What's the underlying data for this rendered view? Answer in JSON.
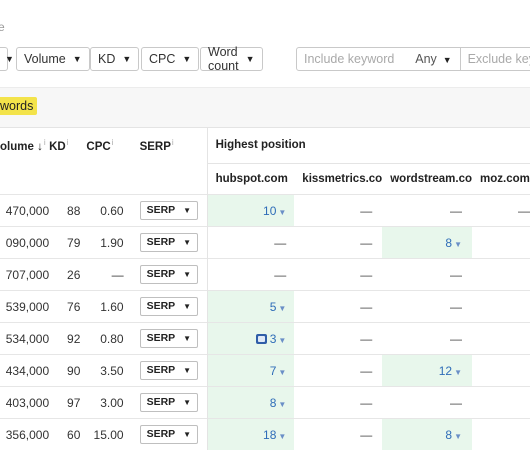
{
  "crumb": "e",
  "filters": {
    "f0": "",
    "volume": "Volume",
    "kd": "KD",
    "cpc": "CPC",
    "word_count": "Word count",
    "include_placeholder": "Include keyword",
    "any": "Any",
    "exclude_placeholder": "Exclude key"
  },
  "tag": "words",
  "headers": {
    "volume": "olume",
    "kd": "KD",
    "cpc": "CPC",
    "serp": "SERP",
    "highest": "Highest position",
    "d1": "hubspot.com",
    "d2": "kissmetrics.co",
    "d3": "wordstream.co",
    "d4": "moz.com"
  },
  "serp_label": "SERP",
  "rows": [
    {
      "vol": "470,000",
      "kd": "88",
      "cpc": "0.60",
      "p1": "10",
      "p2": "—",
      "p3": "—",
      "p4": "—"
    },
    {
      "vol": "090,000",
      "kd": "79",
      "cpc": "1.90",
      "p1": "—",
      "p2": "—",
      "p3": "8",
      "p4": ""
    },
    {
      "vol": "707,000",
      "kd": "26",
      "cpc": "—",
      "p1": "—",
      "p2": "—",
      "p3": "—",
      "p4": ""
    },
    {
      "vol": "539,000",
      "kd": "76",
      "cpc": "1.60",
      "p1": "5",
      "p2": "—",
      "p3": "—",
      "p4": ""
    },
    {
      "vol": "534,000",
      "kd": "92",
      "cpc": "0.80",
      "p1": "3",
      "p2": "—",
      "p3": "—",
      "p4": ""
    },
    {
      "vol": "434,000",
      "kd": "90",
      "cpc": "3.50",
      "p1": "7",
      "p2": "—",
      "p3": "12",
      "p4": ""
    },
    {
      "vol": "403,000",
      "kd": "97",
      "cpc": "3.00",
      "p1": "8",
      "p2": "—",
      "p3": "—",
      "p4": ""
    },
    {
      "vol": "356,000",
      "kd": "60",
      "cpc": "15.00",
      "p1": "18",
      "p2": "—",
      "p3": "8",
      "p4": ""
    }
  ]
}
